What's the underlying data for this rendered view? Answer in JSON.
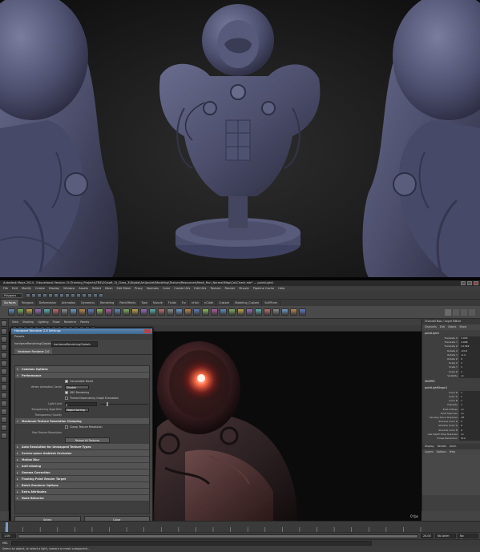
{
  "top_render": {
    "description_colors": {
      "clay": "#4e5070",
      "background": "#1f1f1f"
    }
  },
  "maya": {
    "title": "Autodesk Maya 2014 - Educational Version: D:\\Training_Projects\\TBE\\20(soft_3)_Class_3\\Digital\\Art\\Jacket\\Modeling\\Texture\\Resources\\Mesh_Run_Normal\\Map\\Col\\Check.mb*  ---  pointLight1",
    "menus": [
      "File",
      "Edit",
      "Modify",
      "Create",
      "Display",
      "Window",
      "Assets",
      "Select",
      "Mesh",
      "Edit Mesh",
      "Proxy",
      "Normals",
      "Color",
      "Create UVs",
      "Edit UVs",
      "Texture",
      "Render",
      "Muscle",
      "Pipeline Cache",
      "Help"
    ],
    "mode": "Polygons",
    "shelf_tabs": [
      "Surfaces",
      "Polygons",
      "Deformation",
      "Animation",
      "Dynamics",
      "Rendering",
      "PaintEffects",
      "Toon",
      "Muscle",
      "Fluids",
      "Fur",
      "nHair",
      "nCloth",
      "Custom",
      "Modeling_Custom",
      "SciffFrom"
    ],
    "active_shelf_tab": "Surfaces",
    "panel_menus": [
      "View",
      "Shading",
      "Lighting",
      "Show",
      "Renderer",
      "Panels"
    ],
    "fps": "0 fps"
  },
  "dialog": {
    "title": "Hardware Renderer 2.0 Settings",
    "menu": "Presets",
    "field_label": "hardwareRenderingGlobals",
    "field_value": "hardwareRenderingGlobals",
    "tab": "Hardware Renderer 2.0",
    "sections": {
      "common": "Common Options",
      "performance": "Performance",
      "consolidate": "Consolidate World",
      "vertex_cache_label": "Vertex Animation Cache",
      "vertex_cache_value": "Disable",
      "vbo": "VBO Rendering",
      "thread_eval": "Thread Dependency Graph Evaluation",
      "light_limit_label": "Light Limit",
      "light_limit_value": "8",
      "transparency_label": "Transparency Algorithm",
      "transparency_value": "Object Sorting",
      "transparency_quality_label": "Transparency Quality",
      "max_tex": "Maximum Texture Resolution Clamping",
      "clamp_label": "Clamp Texture Resolution",
      "max_tex_res_label": "Max Texture Resolution",
      "reload_button": "Reload All Textures",
      "auto_res": "Auto Resolution for Unmapped Texture Types",
      "ssao": "Screen-space Ambient Occlusion",
      "motion_blur": "Motion Blur",
      "anti_alias": "Anti-aliasing",
      "gamma": "Gamma Correction",
      "floating_point": "Floating Point Render Target",
      "batch": "Batch Renderer Options",
      "extra": "Extra Attributes",
      "node_behavior": "Node Behavior"
    },
    "footer": {
      "left": "Select",
      "right": "Close"
    }
  },
  "channel_box": {
    "header": "Channel Box / Layer Editor",
    "tabs": [
      "Channels",
      "Edit",
      "Object",
      "Show"
    ],
    "object": "pointLight1",
    "attrs": [
      {
        "n": "Translate X",
        "v": "3.903"
      },
      {
        "n": "Translate Y",
        "v": "4.996"
      },
      {
        "n": "Translate Z",
        "v": "14.392"
      },
      {
        "n": "Rotate X",
        "v": "-23.8"
      },
      {
        "n": "Rotate Y",
        "v": "-2.4"
      },
      {
        "n": "Rotate Z",
        "v": "0"
      },
      {
        "n": "Scale X",
        "v": "1"
      },
      {
        "n": "Scale Y",
        "v": "1"
      },
      {
        "n": "Scale Z",
        "v": "1"
      },
      {
        "n": "Visibility",
        "v": "on"
      }
    ],
    "shapes_header": "SHAPES",
    "shape_name": "pointLightShape1",
    "shape_attrs": [
      {
        "n": "Color R",
        "v": "1"
      },
      {
        "n": "Color G",
        "v": "1"
      },
      {
        "n": "Color B",
        "v": "1"
      },
      {
        "n": "Intensity",
        "v": "1"
      },
      {
        "n": "Emit Diffuse",
        "v": "on"
      },
      {
        "n": "Emit Specular",
        "v": "on"
      },
      {
        "n": "Use Ray Trace Shadows",
        "v": "off"
      },
      {
        "n": "Shadow Color R",
        "v": "0"
      },
      {
        "n": "Shadow Color G",
        "v": "0"
      },
      {
        "n": "Shadow Color B",
        "v": "0"
      },
      {
        "n": "Use Depth Map Shadows",
        "v": "on"
      },
      {
        "n": "Dmap Resolution",
        "v": "512"
      }
    ],
    "layer_tabs": [
      "Display",
      "Render",
      "Anim"
    ],
    "layer_menu": [
      "Layers",
      "Options",
      "Help"
    ]
  },
  "timeline": {
    "start": "1.00",
    "end": "24.00",
    "range_start": "1.00",
    "range_end": "24.00",
    "current": "1.00",
    "anim_layer": "No Anim Layer",
    "char_set": "No Character Set",
    "cmd_label": "MEL",
    "help": "Select an object, or select a light, camera or mesh component..."
  }
}
